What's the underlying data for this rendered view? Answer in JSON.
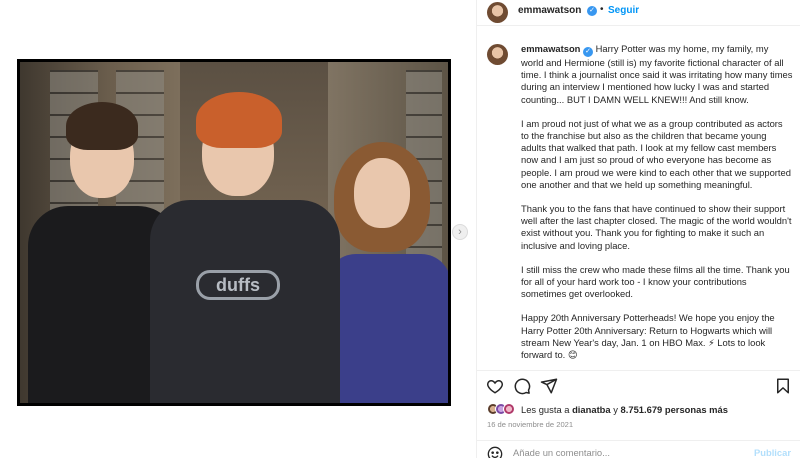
{
  "post": {
    "username": "emmawatson",
    "verified_mark": "✓",
    "dot": "•",
    "follow_label": "Seguir",
    "image_logo_text": "duffs"
  },
  "caption": {
    "username": "emmawatson",
    "paragraphs": [
      "Harry Potter was my home, my family, my world and Hermione (still is) my favorite fictional character of all time. I think a journalist once said it was irritating how many times during an interview I mentioned how lucky I was and started counting... BUT I DAMN WELL KNEW!!! And still know.",
      "I am proud not just of what we as a group contributed as actors to the franchise but also as the children that became young adults that walked that path. I look at my fellow cast members now and I am just so proud of who everyone has become as people. I am proud we were kind to each other that we supported one another and that we held up something meaningful.",
      "Thank you to the fans that have continued to show their support well after the last chapter closed. The magic of the world wouldn't exist without you. Thank you for fighting to make it such an inclusive and loving place.",
      "I still miss the crew who made these films all the time. Thank you for all of your hard work too - I know your contributions sometimes get overlooked.",
      "Happy 20th Anniversary Potterheads! We hope you enjoy the Harry Potter 20th Anniversary: Return to Hogwarts which will stream New Year's day, Jan. 1 on HBO Max. ⚡ Lots to look forward to. 😊"
    ]
  },
  "actions": {
    "icons": [
      "heart-icon",
      "comment-icon",
      "share-icon",
      "bookmark-icon"
    ]
  },
  "likes": {
    "prefix": "Les gusta a ",
    "liker": "dianatba",
    "middle": " y ",
    "count": "8.751.679 personas más"
  },
  "date": "16 de noviembre de 2021",
  "comment": {
    "placeholder": "Añade un comentario...",
    "publish_label": "Publicar"
  },
  "colors": {
    "accent": "#0095f6",
    "verified": "#3897f0",
    "muted": "#8e8e8e",
    "publish_disabled": "#b2dffc"
  }
}
